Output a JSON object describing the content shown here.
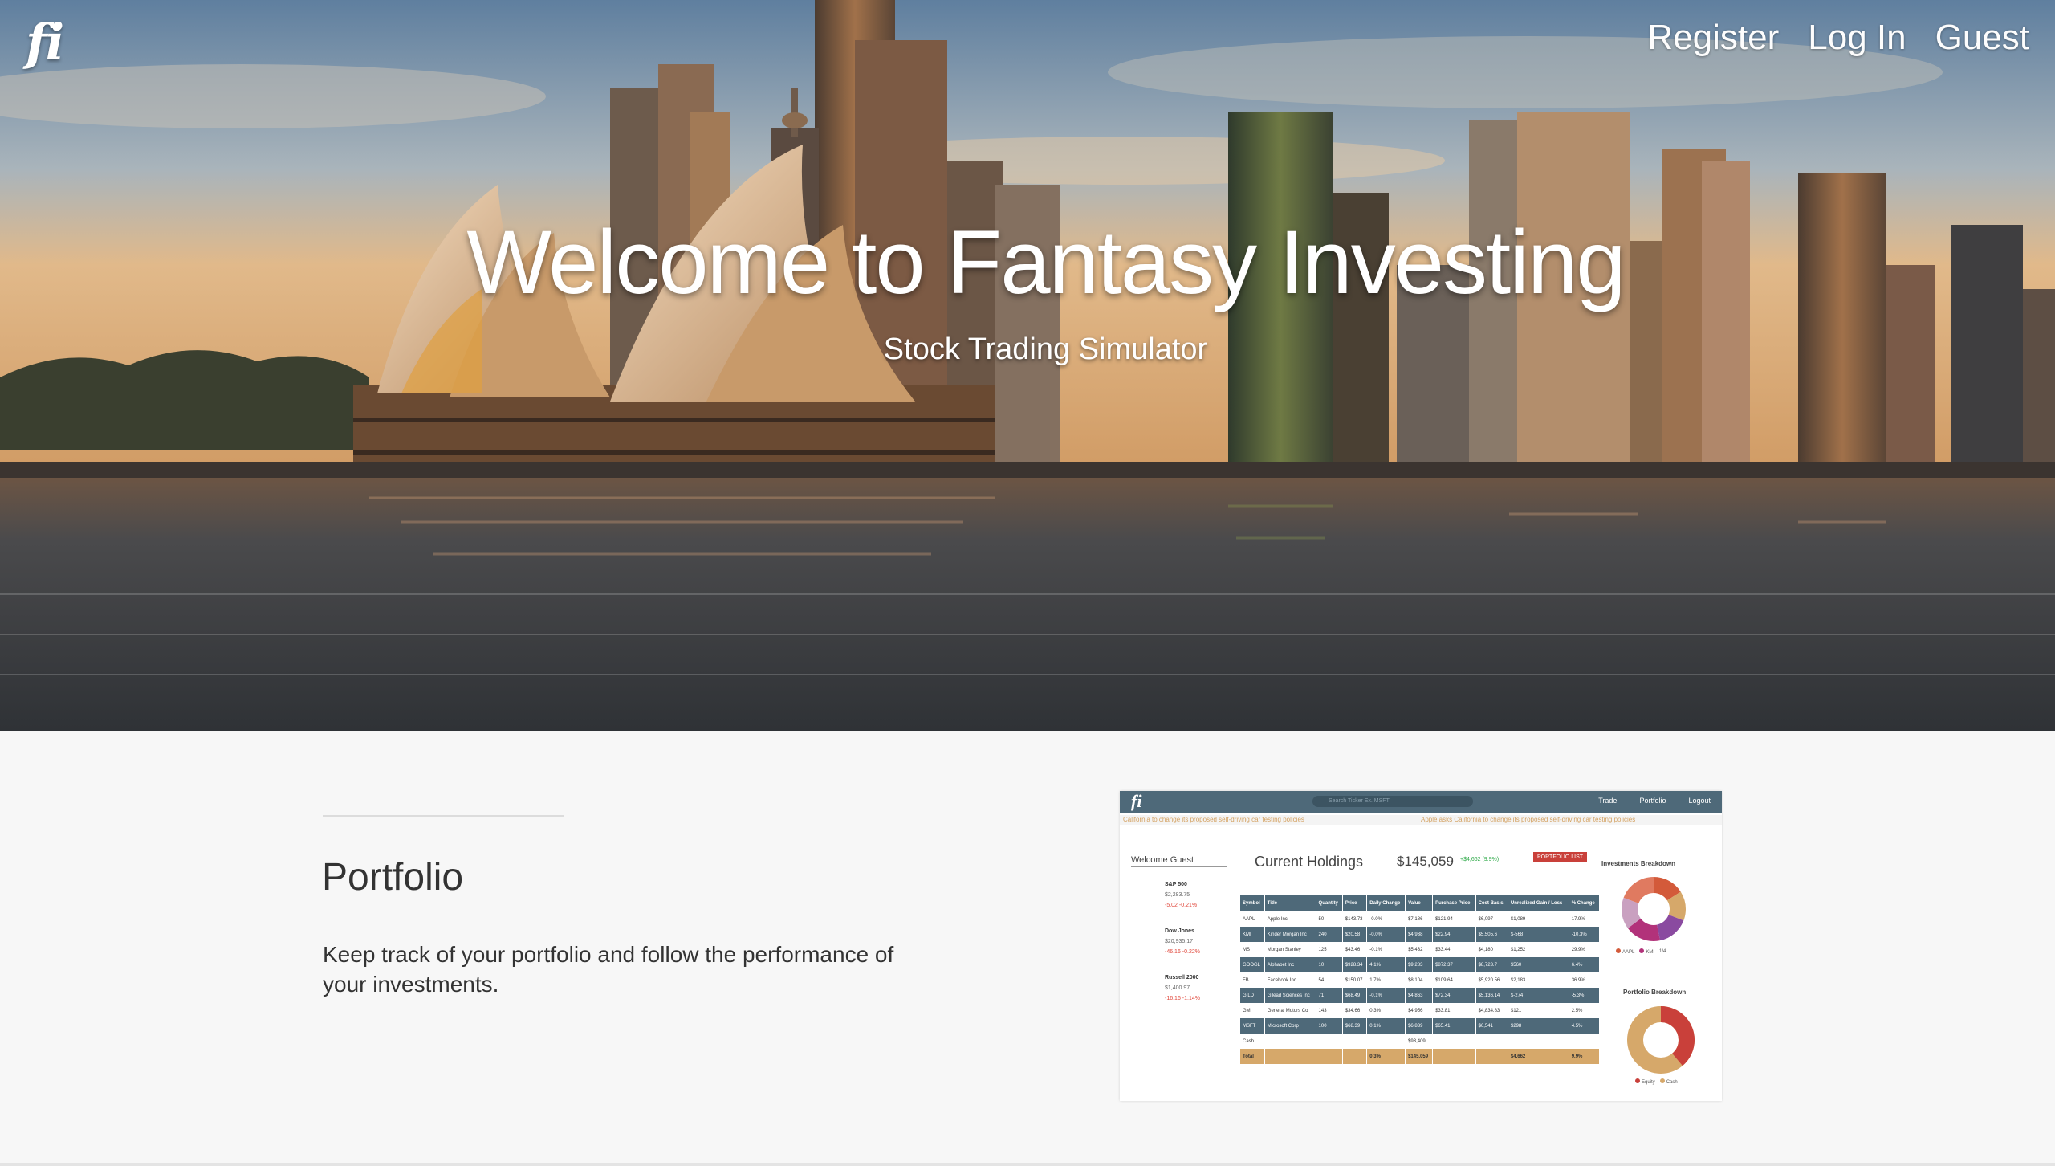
{
  "brand": {
    "logo": "fi"
  },
  "nav": {
    "register": "Register",
    "login": "Log In",
    "guest": "Guest"
  },
  "hero": {
    "title": "Welcome to Fantasy Investing",
    "subtitle": "Stock Trading Simulator"
  },
  "feature": {
    "title": "Portfolio",
    "description": "Keep track of your portfolio and follow the performance of your investments."
  },
  "preview": {
    "logo": "fi",
    "search_placeholder": "Search Ticker Ex. MSFT",
    "nav": [
      "Trade",
      "Portfolio",
      "Logout"
    ],
    "ticker": [
      "California to change its proposed self-driving car testing policies",
      "Apple asks California to change its proposed self-driving car testing policies"
    ],
    "welcome": "Welcome Guest",
    "heading": "Current Holdings",
    "total": "$145,059",
    "total_gain": "+$4,662 (9.9%)",
    "list_button": "PORTFOLIO LIST",
    "indices": [
      {
        "name": "S&P 500",
        "value": "$2,283.75",
        "change": "-5.02 -0.21%"
      },
      {
        "name": "Dow Jones",
        "value": "$20,935.17",
        "change": "-46.16 -0.22%"
      },
      {
        "name": "Russell 2000",
        "value": "$1,400.97",
        "change": "-16.16 -1.14%"
      }
    ],
    "columns": [
      "Symbol",
      "Title",
      "Quantity",
      "Price",
      "Daily Change",
      "Value",
      "Purchase Price",
      "Cost Basis",
      "Unrealized Gain / Loss",
      "% Change"
    ],
    "rows": [
      [
        "AAPL",
        "Apple Inc",
        "50",
        "$143.73",
        "-0.0%",
        "$7,186",
        "$121.94",
        "$6,097",
        "$1,089",
        "17.9%"
      ],
      [
        "KMI",
        "Kinder Morgan Inc",
        "240",
        "$20.58",
        "-0.0%",
        "$4,938",
        "$22.94",
        "$5,505.6",
        "$-568",
        "-10.3%"
      ],
      [
        "MS",
        "Morgan Stanley",
        "125",
        "$43.46",
        "-0.1%",
        "$5,432",
        "$33.44",
        "$4,180",
        "$1,252",
        "29.9%"
      ],
      [
        "GOOGL",
        "Alphabet Inc",
        "10",
        "$928.34",
        "4.1%",
        "$9,283",
        "$872.37",
        "$8,723.7",
        "$560",
        "6.4%"
      ],
      [
        "FB",
        "Facebook Inc",
        "54",
        "$150.07",
        "1.7%",
        "$8,104",
        "$109.64",
        "$5,920.56",
        "$2,183",
        "36.9%"
      ],
      [
        "GILD",
        "Gilead Sciences Inc",
        "71",
        "$68.49",
        "-0.1%",
        "$4,863",
        "$72.34",
        "$5,136.14",
        "$-274",
        "-5.3%"
      ],
      [
        "GM",
        "General Motors Co",
        "143",
        "$34.66",
        "0.3%",
        "$4,956",
        "$33.81",
        "$4,834.83",
        "$121",
        "2.5%"
      ],
      [
        "MSFT",
        "Microsoft Corp",
        "100",
        "$68.39",
        "0.1%",
        "$6,839",
        "$65.41",
        "$6,541",
        "$298",
        "4.5%"
      ],
      [
        "Cash",
        "",
        "",
        "",
        "",
        "$93,409",
        "",
        "",
        "",
        ""
      ],
      [
        "Total",
        "",
        "",
        "",
        "0.3%",
        "$145,059",
        "",
        "",
        "$4,662",
        "9.9%"
      ]
    ],
    "investments_title": "Investments Breakdown",
    "investments_legend": [
      "AAPL",
      "KMI",
      "1/4"
    ],
    "portfolio_title": "Portfolio Breakdown",
    "portfolio_legend": [
      "Equity",
      "Cash"
    ],
    "colors": {
      "bar": "#4e6979",
      "total_row": "#d6a86a",
      "list_button": "#c9403a",
      "gain": "#2aa845",
      "loss": "#e0463a"
    }
  }
}
